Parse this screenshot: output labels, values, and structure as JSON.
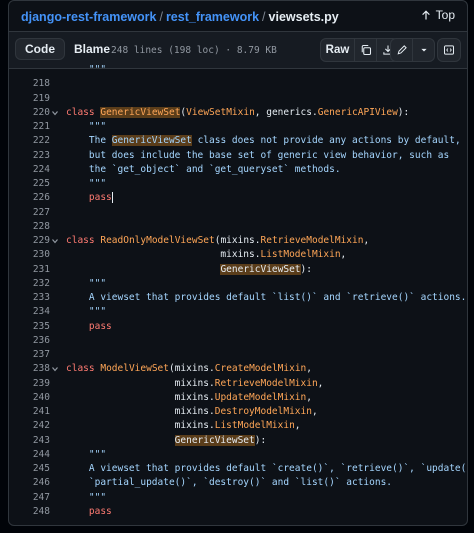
{
  "breadcrumb": {
    "repo": "django-rest-framework",
    "folder": "rest_framework",
    "file": "viewsets.py",
    "separator": "/"
  },
  "top_label": "Top",
  "tabs": {
    "code": "Code",
    "blame": "Blame"
  },
  "file_info": "248 lines (198 loc) · 8.79 KB",
  "toolbar": {
    "raw": "Raw",
    "icons": [
      "copy-icon",
      "download-icon",
      "pencil-icon",
      "chevron-down-icon",
      "symbols-icon"
    ]
  },
  "code_lines": [
    {
      "n": "",
      "t": "    \"\"\"",
      "partial": true
    },
    {
      "n": "218",
      "t": ""
    },
    {
      "n": "219",
      "t": ""
    },
    {
      "n": "220",
      "t": "class GenericViewSet(ViewSetMixin, generics.GenericAPIView):",
      "fold": true
    },
    {
      "n": "221",
      "t": "    \"\"\""
    },
    {
      "n": "222",
      "t": "    The GenericViewSet class does not provide any actions by default,"
    },
    {
      "n": "223",
      "t": "    but does include the base set of generic view behavior, such as"
    },
    {
      "n": "224",
      "t": "    the `get_object` and `get_queryset` methods."
    },
    {
      "n": "225",
      "t": "    \"\"\""
    },
    {
      "n": "226",
      "t": "    pass"
    },
    {
      "n": "227",
      "t": ""
    },
    {
      "n": "228",
      "t": ""
    },
    {
      "n": "229",
      "t": "class ReadOnlyModelViewSet(mixins.RetrieveModelMixin,",
      "fold": true
    },
    {
      "n": "230",
      "t": "                           mixins.ListModelMixin,"
    },
    {
      "n": "231",
      "t": "                           GenericViewSet):"
    },
    {
      "n": "232",
      "t": "    \"\"\""
    },
    {
      "n": "233",
      "t": "    A viewset that provides default `list()` and `retrieve()` actions."
    },
    {
      "n": "234",
      "t": "    \"\"\""
    },
    {
      "n": "235",
      "t": "    pass"
    },
    {
      "n": "236",
      "t": ""
    },
    {
      "n": "237",
      "t": ""
    },
    {
      "n": "238",
      "t": "class ModelViewSet(mixins.CreateModelMixin,",
      "fold": true
    },
    {
      "n": "239",
      "t": "                   mixins.RetrieveModelMixin,"
    },
    {
      "n": "240",
      "t": "                   mixins.UpdateModelMixin,"
    },
    {
      "n": "241",
      "t": "                   mixins.DestroyModelMixin,"
    },
    {
      "n": "242",
      "t": "                   mixins.ListModelMixin,"
    },
    {
      "n": "243",
      "t": "                   GenericViewSet):"
    },
    {
      "n": "244",
      "t": "    \"\"\""
    },
    {
      "n": "245",
      "t": "    A viewset that provides default `create()`, `retrieve()`, `update()`,"
    },
    {
      "n": "246",
      "t": "    `partial_update()`, `destroy()` and `list()` actions."
    },
    {
      "n": "247",
      "t": "    \"\"\""
    },
    {
      "n": "248",
      "t": "    pass"
    }
  ],
  "highlight_word": "GenericViewSet",
  "colors": {
    "link": "#4493f8",
    "keyword": "#ff7b72",
    "class_name": "#ffa657",
    "string": "#a5d6ff",
    "highlight_bg": "#5a3d1a",
    "background": "#0d1117"
  }
}
